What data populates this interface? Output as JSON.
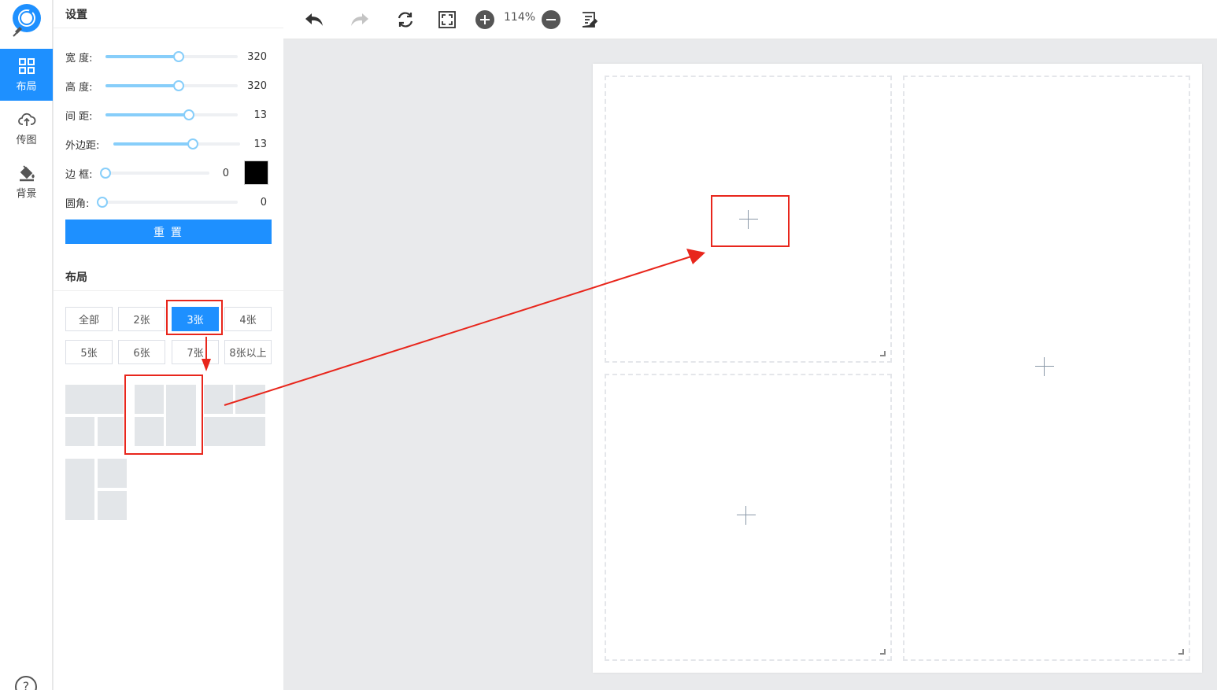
{
  "rail": {
    "items": [
      {
        "label": "布局",
        "icon": "layout-grid-icon",
        "active": true
      },
      {
        "label": "传图",
        "icon": "cloud-upload-icon",
        "active": false
      },
      {
        "label": "背景",
        "icon": "paint-bucket-icon",
        "active": false
      }
    ],
    "help": "?"
  },
  "settings": {
    "title": "设置",
    "width": {
      "label": "宽 度:",
      "value": "320",
      "level": 0.55
    },
    "height": {
      "label": "高 度:",
      "value": "320",
      "level": 0.55
    },
    "spacing": {
      "label": "间 距:",
      "value": "13",
      "level": 0.63
    },
    "margin": {
      "label": "外边距:",
      "value": "13",
      "level": 0.63
    },
    "border": {
      "label": "边 框:",
      "value": "0",
      "level": 0,
      "color": "#000000"
    },
    "radius": {
      "label": "圆角:",
      "value": "0",
      "level": 0
    },
    "reset_label": "重 置"
  },
  "layout": {
    "title": "布局",
    "buttons": [
      "全部",
      "2张",
      "3张",
      "4张",
      "5张",
      "6张",
      "7张",
      "8张以上"
    ],
    "active": "3张"
  },
  "toolbar": {
    "zoom": "114%"
  },
  "colors": {
    "accent": "#1e90ff",
    "slider": "#87cefa",
    "annotation": "#e8261c"
  }
}
